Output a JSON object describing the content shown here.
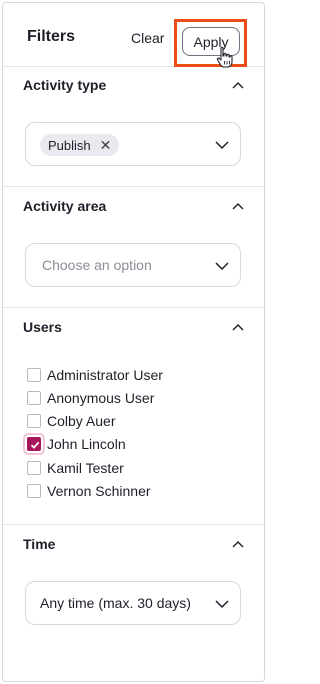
{
  "header": {
    "title": "Filters",
    "clear_label": "Clear",
    "apply_label": "Apply"
  },
  "sections": {
    "activity_type": {
      "title": "Activity type",
      "selected_chip": "Publish"
    },
    "activity_area": {
      "title": "Activity area",
      "placeholder": "Choose an option"
    },
    "users": {
      "title": "Users",
      "items": [
        {
          "label": "Administrator User",
          "checked": false
        },
        {
          "label": "Anonymous User",
          "checked": false
        },
        {
          "label": "Colby Auer",
          "checked": false
        },
        {
          "label": "John Lincoln",
          "checked": true
        },
        {
          "label": "Kamil Tester",
          "checked": false
        },
        {
          "label": "Vernon Schinner",
          "checked": false
        }
      ]
    },
    "time": {
      "title": "Time",
      "selected": "Any time (max. 30 days)"
    }
  },
  "colors": {
    "highlight_border": "#ea4d16",
    "checkbox_checked": "#a8155a"
  },
  "icons": {
    "section_toggle": "chevron-up-icon",
    "dropdown": "chevron-down-icon",
    "chip_remove": "close-icon",
    "pointer": "hand-cursor-icon"
  }
}
